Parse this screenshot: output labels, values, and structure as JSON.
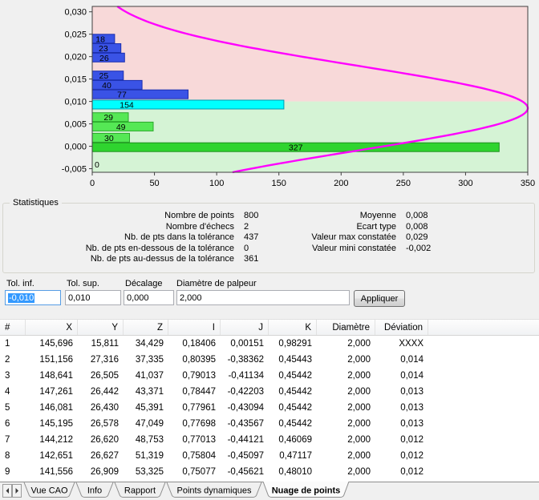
{
  "chart_data": {
    "type": "bar",
    "orientation": "horizontal",
    "title": "",
    "xlabel": "",
    "ylabel": "",
    "x_axis": {
      "min": 0,
      "max": 350,
      "ticks": [
        0,
        50,
        100,
        150,
        200,
        250,
        300,
        350
      ]
    },
    "y_axis": {
      "min": -0.005,
      "max": 0.03,
      "tick_values": [
        0.03,
        0.025,
        0.02,
        0.015,
        0.01,
        0.005,
        0.0,
        -0.005
      ],
      "ticks": [
        "0,030",
        "0,025",
        "0,020",
        "0,015",
        "0,010",
        "0,005",
        "0,000",
        "-0,005"
      ]
    },
    "bins": [
      {
        "value": 0.024,
        "count": 18,
        "color": "blue",
        "label_frac": 0.36
      },
      {
        "value": 0.0219,
        "count": 23,
        "color": "blue",
        "label_frac": 0.39
      },
      {
        "value": 0.0198,
        "count": 26,
        "color": "blue",
        "label_frac": 0.37
      },
      {
        "value": 0.0158,
        "count": 25,
        "color": "blue",
        "label_frac": 0.37
      },
      {
        "value": 0.0137,
        "count": 40,
        "color": "blue",
        "label_frac": 0.29
      },
      {
        "value": 0.0116,
        "count": 77,
        "color": "blue",
        "label_frac": 0.31
      },
      {
        "value": 0.0093,
        "count": 154,
        "color": "cyan",
        "label_frac": 0.18
      },
      {
        "value": 0.0065,
        "count": 29,
        "color": "lightgreen",
        "label_frac": 0.45
      },
      {
        "value": 0.0044,
        "count": 49,
        "color": "lightgreen",
        "label_frac": 0.47
      },
      {
        "value": 0.0019,
        "count": 30,
        "color": "lightgreen",
        "label_frac": 0.45
      },
      {
        "value": -0.0002,
        "count": 327,
        "color": "green",
        "label_frac": 0.5
      },
      {
        "value": -0.004,
        "count": 0,
        "color": "none",
        "label_frac": 0.5
      }
    ],
    "curve": {
      "shape": "gaussian",
      "mean": 0.0085,
      "std": 0.0095,
      "peak": 350,
      "color": "#ff00ff"
    },
    "zones": {
      "boundary": 0.01,
      "upper_color": "#f8d9d9",
      "lower_color": "#d5f3d5"
    },
    "colors": {
      "blue": "#3a53e6",
      "cyan": "#00ffff",
      "lightgreen": "#55e855",
      "green": "#2fd42f"
    },
    "stroke_colors": {
      "blue": "#1c2fb0",
      "cyan": "#009bb0",
      "lightgreen": "#2aa82a",
      "green": "#1d8f1d"
    },
    "legend": "none",
    "grid": false
  },
  "stats": {
    "title": "Statistiques",
    "left": [
      {
        "label": "Nombre de points",
        "value": "800"
      },
      {
        "label": "Nombre d'échecs",
        "value": "2"
      },
      {
        "label": "Nb. de pts dans la tolérance",
        "value": "437"
      },
      {
        "label": "Nb. de pts en-dessous de la tolérance",
        "value": "0"
      },
      {
        "label": "Nb. de pts au-dessus de la tolérance",
        "value": "361"
      }
    ],
    "right": [
      {
        "label": "Moyenne",
        "value": "0,008"
      },
      {
        "label": "Ecart type",
        "value": "0,008"
      },
      {
        "label": "Valeur max constatée",
        "value": "0,029"
      },
      {
        "label": "Valeur mini constatée",
        "value": "-0,002"
      }
    ]
  },
  "tolerance": {
    "fields": [
      {
        "name": "tol-inf",
        "label": "Tol. inf.",
        "value": "-0,010",
        "selected": true
      },
      {
        "name": "tol-sup",
        "label": "Tol. sup.",
        "value": "0,010",
        "selected": false
      },
      {
        "name": "decalage",
        "label": "Décalage",
        "value": "0,000",
        "selected": false
      },
      {
        "name": "diametre-palpeur",
        "label": "Diamètre de palpeur",
        "value": "2,000",
        "selected": false
      }
    ],
    "apply_label": "Appliquer"
  },
  "table": {
    "columns": [
      "#",
      "X",
      "Y",
      "Z",
      "I",
      "J",
      "K",
      "Diamètre",
      "Déviation"
    ],
    "rows": [
      [
        "1",
        "145,696",
        "15,811",
        "34,429",
        "0,18406",
        "0,00151",
        "0,98291",
        "2,000",
        "XXXX"
      ],
      [
        "2",
        "151,156",
        "27,316",
        "37,335",
        "0,80395",
        "-0,38362",
        "0,45443",
        "2,000",
        "0,014"
      ],
      [
        "3",
        "148,641",
        "26,505",
        "41,037",
        "0,79013",
        "-0,41134",
        "0,45442",
        "2,000",
        "0,014"
      ],
      [
        "4",
        "147,261",
        "26,442",
        "43,371",
        "0,78447",
        "-0,42203",
        "0,45442",
        "2,000",
        "0,013"
      ],
      [
        "5",
        "146,081",
        "26,430",
        "45,391",
        "0,77961",
        "-0,43094",
        "0,45442",
        "2,000",
        "0,013"
      ],
      [
        "6",
        "145,195",
        "26,578",
        "47,049",
        "0,77698",
        "-0,43567",
        "0,45442",
        "2,000",
        "0,013"
      ],
      [
        "7",
        "144,212",
        "26,620",
        "48,753",
        "0,77013",
        "-0,44121",
        "0,46069",
        "2,000",
        "0,012"
      ],
      [
        "8",
        "142,651",
        "26,627",
        "51,319",
        "0,75804",
        "-0,45097",
        "0,47117",
        "2,000",
        "0,012"
      ],
      [
        "9",
        "141,556",
        "26,909",
        "53,325",
        "0,75077",
        "-0,45621",
        "0,48010",
        "2,000",
        "0,012"
      ]
    ]
  },
  "tabs": {
    "items": [
      "Vue CAO",
      "Info",
      "Rapport",
      "Points dynamiques",
      "Nuage de points"
    ],
    "active_index": 4,
    "scroll_icons": [
      "left-arrow-icon",
      "right-arrow-icon"
    ]
  }
}
